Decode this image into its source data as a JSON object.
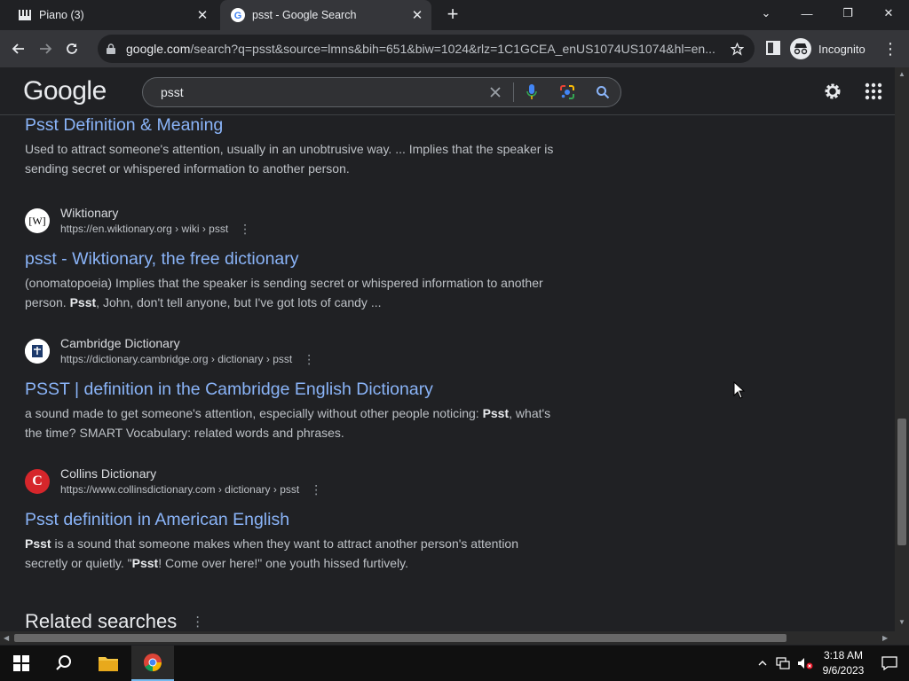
{
  "browser": {
    "tabs": [
      {
        "title": "Piano (3)",
        "icon": "piano-icon",
        "active": false
      },
      {
        "title": "psst - Google Search",
        "icon": "google-g-icon",
        "active": true
      }
    ],
    "url_domain": "google.com",
    "url_rest": "/search?q=psst&source=lmns&bih=651&biw=1024&rlz=1C1GCEA_enUS1074US1074&hl=en...",
    "profile_label": "Incognito"
  },
  "google": {
    "logo": [
      "G",
      "o",
      "o",
      "g",
      "l",
      "e"
    ],
    "logo_colors": [
      "#8ab4f8",
      "#f28b82",
      "#fdd663",
      "#8ab4f8",
      "#81c995",
      "#f28b82"
    ],
    "query": "psst"
  },
  "results": [
    {
      "title": "Psst Definition & Meaning",
      "snippet": "Used to attract someone's attention, usually in an unobtrusive way. ... Implies that the speaker is sending secret or whispered information to another person."
    },
    {
      "source": "Wiktionary",
      "url": "https://en.wiktionary.org › wiki › psst",
      "title": "psst - Wiktionary, the free dictionary",
      "snippet_parts": [
        "(onomatopoeia) Implies that the speaker is sending secret or whispered information to another person. ",
        "Psst",
        ", John, don't tell anyone, but I've got lots of candy ..."
      ],
      "icon": "wiktionary-icon",
      "favicon_text": "[W]"
    },
    {
      "source": "Cambridge Dictionary",
      "url": "https://dictionary.cambridge.org › dictionary › psst",
      "title": "PSST | definition in the Cambridge English Dictionary",
      "snippet_parts": [
        "a sound made to get someone's attention, especially without other people noticing: ",
        "Psst",
        ", what's the time? SMART Vocabulary: related words and phrases."
      ],
      "icon": "cambridge-icon"
    },
    {
      "source": "Collins Dictionary",
      "url": "https://www.collinsdictionary.com › dictionary › psst",
      "title": "Psst definition in American English",
      "snippet_parts": [
        "",
        "Psst",
        " is a sound that someone makes when they want to attract another person's attention secretly or quietly. \"",
        "Psst",
        "! Come over here!\" one youth hissed furtively."
      ],
      "icon": "collins-icon",
      "favicon_text": "C"
    }
  ],
  "related_heading": "Related searches",
  "taskbar": {
    "time": "3:18 AM",
    "date": "9/6/2023"
  }
}
